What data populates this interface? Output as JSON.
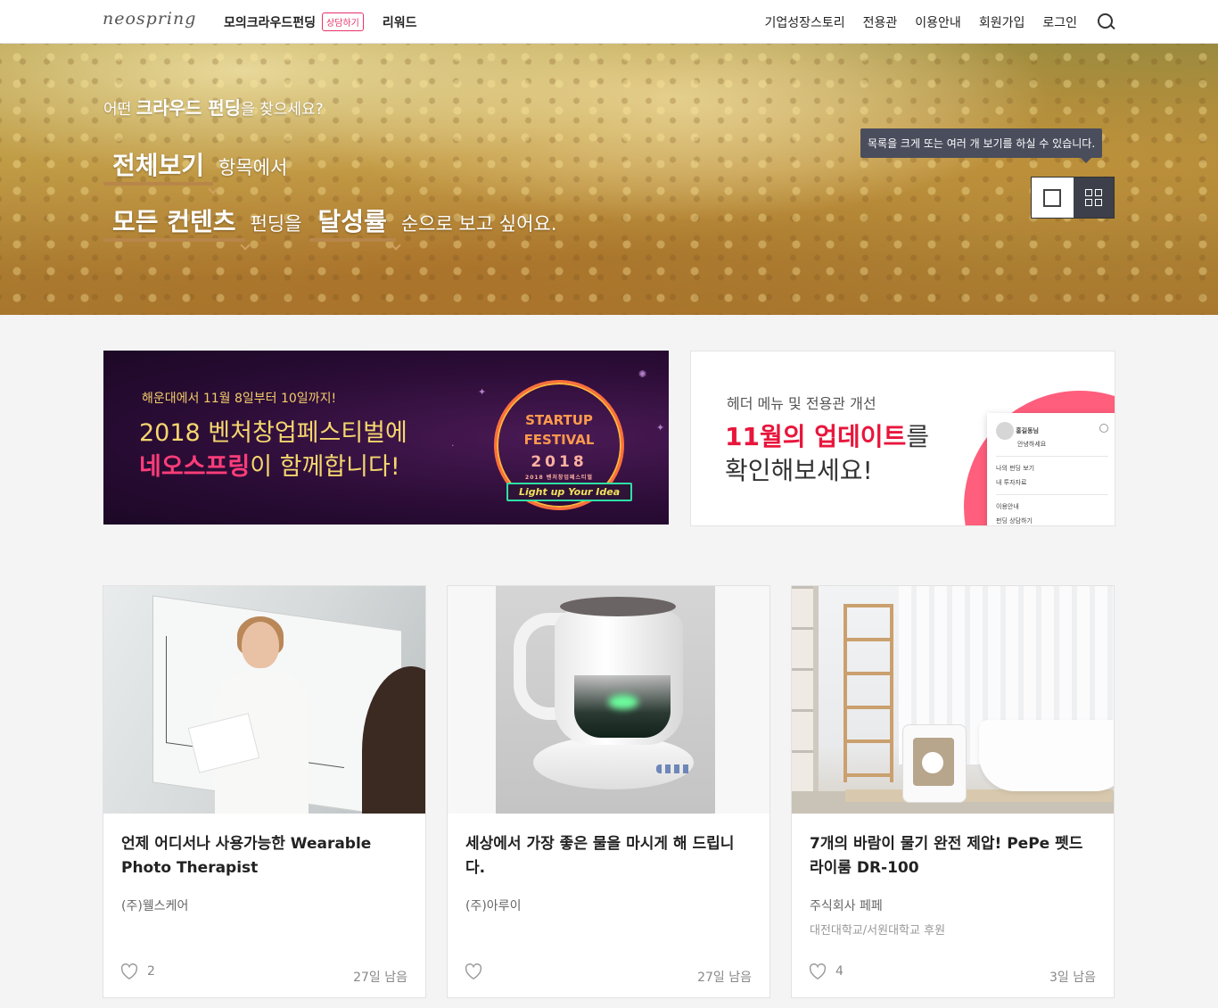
{
  "header": {
    "logo": "neospring",
    "nav_left": [
      "모의크라우드펀딩",
      "리워드"
    ],
    "badge": "상담하기",
    "nav_right": [
      "기업성장스토리",
      "전용관",
      "이용안내",
      "회원가입",
      "로그인"
    ]
  },
  "hero": {
    "question_pre": "어떤 ",
    "question_bold": "크라우드 펀딩",
    "question_post": "을 찾으세요?",
    "filter_category": "전체보기",
    "text_category": "항목에서",
    "filter_content": "모든 컨텐츠",
    "text_funding": "펀딩을",
    "filter_sort": "달성률",
    "text_sort": "순으로 보고 싶어요.",
    "tooltip": "목록을 크게 또는 여러 개 보기를 하실 수 있습니다."
  },
  "banner1": {
    "small": "해운대에서 11월 8일부터 10일까지!",
    "line1": "2018 벤처창업페스티벌에",
    "line2_pink": "네오스프링",
    "line2_rest": "이 함께합니다!",
    "fest_title_1": "STARTUP",
    "fest_title_2": "FESTIVAL",
    "fest_year": "2018",
    "fest_sub": "2018 벤처창업페스티벌",
    "fest_ribbon": "Light up Your Idea"
  },
  "banner2": {
    "small": "헤더 메뉴 및 전용관 개선",
    "line1_red": "11월의 업데이트",
    "line1_rest": "를",
    "line2": "확인해보세요!",
    "mini_name": "홍길동님",
    "mini_greet": "안녕하세요",
    "mini_items": [
      "나의 펀딩 보기",
      "내 투자자료",
      "이용안내",
      "펀딩 상담하기"
    ]
  },
  "cards": [
    {
      "title": "언제 어디서나 사용가능한 Wearable Photo Therapist",
      "company": "(주)웰스케어",
      "sponsor": "",
      "likes": "2",
      "days": "27일 남음"
    },
    {
      "title": "세상에서 가장 좋은 물을 마시게 해 드립니다.",
      "company": "(주)아루이",
      "sponsor": "",
      "likes": "",
      "days": "27일 남음"
    },
    {
      "title": "7개의 바람이 물기 완전 제압! PePe 펫드라이룸 DR-100",
      "company": "주식회사 페페",
      "sponsor": "대전대학교/서원대학교 후원",
      "likes": "4",
      "days": "3일 남음"
    }
  ],
  "colors": {
    "accent_pink": "#e8316b",
    "brand_red": "#e8163c",
    "tooltip_bg": "#4a4d5c"
  }
}
